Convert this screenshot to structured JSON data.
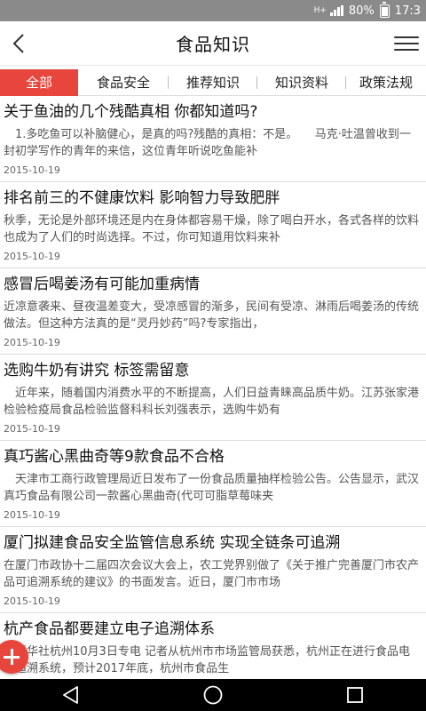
{
  "statusbar": {
    "network": "H+",
    "battery_percent": "80%",
    "time": "17:3"
  },
  "header": {
    "title": "食品知识",
    "back_icon": "chevron-left-icon",
    "menu_icon": "hamburger-menu-icon"
  },
  "tabs": [
    {
      "label": "全部",
      "active": true
    },
    {
      "label": "食品安全",
      "active": false
    },
    {
      "label": "推荐知识",
      "active": false
    },
    {
      "label": "知识资料",
      "active": false
    },
    {
      "label": "政策法规",
      "active": false
    }
  ],
  "articles": [
    {
      "title": "关于鱼油的几个残酷真相 你都知道吗?",
      "summary": "　1.多吃鱼可以补脑健心，是真的吗?残酷的真相：不是。　　马克·吐温曾收到一封初学写作的青年的来信，这位青年听说吃鱼能补",
      "date": "2015-10-19"
    },
    {
      "title": "排名前三的不健康饮料 影响智力导致肥胖",
      "summary": "秋季，无论是外部环境还是内在身体都容易干燥，除了喝白开水，各式各样的饮料也成为了人们的时尚选择。不过，你可知道用饮料来补",
      "date": "2015-10-19"
    },
    {
      "title": "感冒后喝姜汤有可能加重病情",
      "summary": "近凉意袭来、昼夜温差变大，受凉感冒的渐多，民间有受凉、淋雨后喝姜汤的传统做法。但这种方法真的是“灵丹妙药”吗?专家指出，",
      "date": "2015-10-19"
    },
    {
      "title": "选购牛奶有讲究 标签需留意",
      "summary": "　近年来，随着国内消费水平的不断提高，人们日益青睐高品质牛奶。江苏张家港检验检疫局食品检验监督科科长刘强表示，选购牛奶有",
      "date": "2015-10-19"
    },
    {
      "title": "真巧酱心黑曲奇等9款食品不合格",
      "summary": "　天津市工商行政管理局近日发布了一份食品质量抽样检验公告。公告显示，武汉真巧食品有限公司一款酱心黑曲奇(代可可脂草莓味夹",
      "date": "2015-10-19"
    },
    {
      "title": "厦门拟建食品安全监管信息系统 实现全链条可追溯",
      "summary": "在厦门市政协十二届四次会议大会上，农工党界别做了《关于推广完善厦门市农产品可追溯系统的建议》的书面发言。近日，厦门市市场",
      "date": "2015-10-19"
    },
    {
      "title": "杭产食品都要建立电子追溯体系",
      "summary": "　新华社杭州10月3日专电 记者从杭州市市场监管局获悉，杭州正在进行食品电子追溯系统，预计2017年底，杭州市食品生",
      "date": ""
    }
  ],
  "fab": {
    "icon": "plus-icon"
  },
  "navbar": {
    "back_icon": "nav-back-icon",
    "home_icon": "nav-home-icon",
    "recents_icon": "nav-recents-icon"
  }
}
